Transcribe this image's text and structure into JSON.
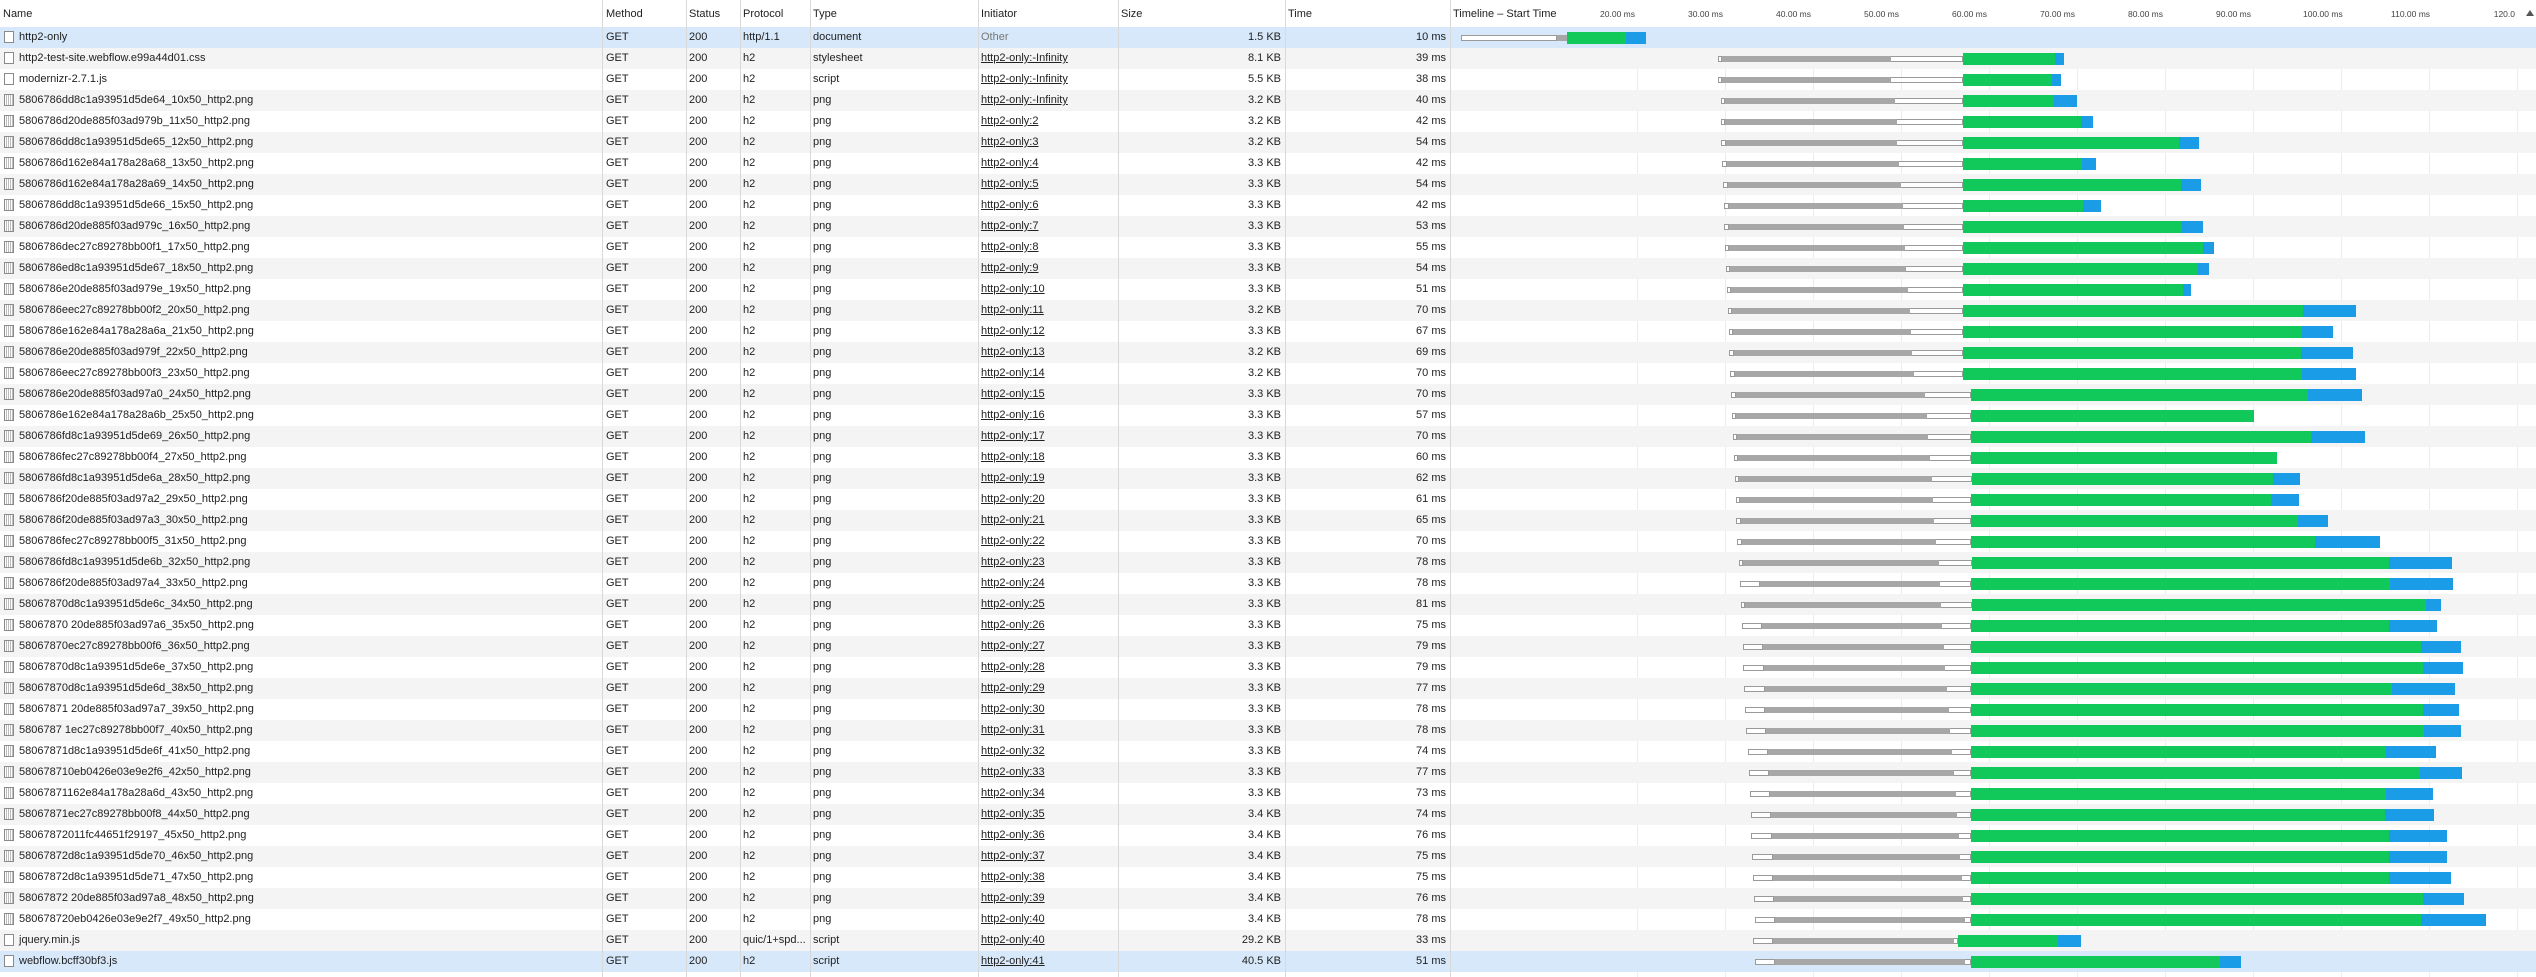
{
  "columns": {
    "name": "Name",
    "method": "Method",
    "status": "Status",
    "protocol": "Protocol",
    "type": "Type",
    "initiator": "Initiator",
    "size": "Size",
    "time": "Time",
    "timeline": "Timeline – Start Time"
  },
  "timeline_ticks": [
    {
      "label": "20.00 ms",
      "ms": 20
    },
    {
      "label": "30.00 ms",
      "ms": 30
    },
    {
      "label": "40.00 ms",
      "ms": 40
    },
    {
      "label": "50.00 ms",
      "ms": 50
    },
    {
      "label": "60.00 ms",
      "ms": 60
    },
    {
      "label": "70.00 ms",
      "ms": 70
    },
    {
      "label": "80.00 ms",
      "ms": 80
    },
    {
      "label": "90.00 ms",
      "ms": 90
    },
    {
      "label": "100.00 ms",
      "ms": 100
    },
    {
      "label": "110.00 ms",
      "ms": 110
    },
    {
      "label": "120.0",
      "ms": 120
    }
  ],
  "icons": {
    "document": "document-icon",
    "stylesheet": "stylesheet-icon",
    "script": "script-icon",
    "png": "image-icon",
    "sort": "sort-ascending-icon"
  },
  "colors": {
    "receiving": "#11c95a",
    "content_download": "#1a9ce6",
    "waiting": "#a7a7a7",
    "selected_row": "#d7e8fa"
  },
  "requests": [
    {
      "name": "http2-only",
      "method": "GET",
      "status": "200",
      "protocol": "http/1.1",
      "type": "document",
      "initiator": "Other",
      "size": "1.5 KB",
      "time": "10 ms",
      "start": 0,
      "queue": 10.9,
      "wait": 1.2,
      "stall": 0,
      "recv": 6.7,
      "dl": 2.2
    },
    {
      "name": "http2-test-site.webflow.e99a44d01.css",
      "method": "GET",
      "status": "200",
      "protocol": "h2",
      "type": "stylesheet",
      "initiator": "http2-only:-Infinity",
      "size": "8.1 KB",
      "time": "39 ms",
      "start": 29.2,
      "queue": 0.5,
      "wait": 19.2,
      "stall": 8.1,
      "recv": 10.5,
      "dl": 1
    },
    {
      "name": "modernizr-2.7.1.js",
      "method": "GET",
      "status": "200",
      "protocol": "h2",
      "type": "script",
      "initiator": "http2-only:-Infinity",
      "size": "5.5 KB",
      "time": "38 ms",
      "start": 29.2,
      "queue": 0.5,
      "wait": 19.2,
      "stall": 8.1,
      "recv": 10.2,
      "dl": 1
    },
    {
      "name": "5806786dd8c1a93951d5de64_10x50_http2.png",
      "method": "GET",
      "status": "200",
      "protocol": "h2",
      "type": "png",
      "initiator": "http2-only:-Infinity",
      "size": "3.2 KB",
      "time": "40 ms",
      "start": 29.5,
      "queue": 0.5,
      "wait": 19.3,
      "stall": 7.7,
      "recv": 10.4,
      "dl": 2.6
    },
    {
      "name": "5806786d20de885f03ad979b_11x50_http2.png",
      "method": "GET",
      "status": "200",
      "protocol": "h2",
      "type": "png",
      "initiator": "http2-only:2",
      "size": "3.2 KB",
      "time": "42 ms",
      "start": 29.5,
      "queue": 0.5,
      "wait": 19.5,
      "stall": 7.5,
      "recv": 13.4,
      "dl": 1.4
    },
    {
      "name": "5806786dd8c1a93951d5de65_12x50_http2.png",
      "method": "GET",
      "status": "200",
      "protocol": "h2",
      "type": "png",
      "initiator": "http2-only:3",
      "size": "3.2 KB",
      "time": "54 ms",
      "start": 29.6,
      "queue": 0.5,
      "wait": 19.5,
      "stall": 7.4,
      "recv": 24.6,
      "dl": 2.3
    },
    {
      "name": "5806786d162e84a178a28a68_13x50_http2.png",
      "method": "GET",
      "status": "200",
      "protocol": "h2",
      "type": "png",
      "initiator": "http2-only:4",
      "size": "3.3 KB",
      "time": "42 ms",
      "start": 29.7,
      "queue": 0.5,
      "wait": 19.6,
      "stall": 7.2,
      "recv": 13.6,
      "dl": 1.6
    },
    {
      "name": "5806786d162e84a178a28a69_14x50_http2.png",
      "method": "GET",
      "status": "200",
      "protocol": "h2",
      "type": "png",
      "initiator": "http2-only:5",
      "size": "3.3 KB",
      "time": "54 ms",
      "start": 29.8,
      "queue": 0.5,
      "wait": 19.7,
      "stall": 7,
      "recv": 24.8,
      "dl": 2.3
    },
    {
      "name": "5806786dd8c1a93951d5de66_15x50_http2.png",
      "method": "GET",
      "status": "200",
      "protocol": "h2",
      "type": "png",
      "initiator": "http2-only:6",
      "size": "3.3 KB",
      "time": "42 ms",
      "start": 29.9,
      "queue": 0.5,
      "wait": 19.8,
      "stall": 6.8,
      "recv": 13.7,
      "dl": 2
    },
    {
      "name": "5806786d20de885f03ad979c_16x50_http2.png",
      "method": "GET",
      "status": "200",
      "protocol": "h2",
      "type": "png",
      "initiator": "http2-only:7",
      "size": "3.3 KB",
      "time": "53 ms",
      "start": 29.9,
      "queue": 0.5,
      "wait": 19.9,
      "stall": 6.7,
      "recv": 24.9,
      "dl": 2.4
    },
    {
      "name": "5806786dec27c89278bb00f1_17x50_http2.png",
      "method": "GET",
      "status": "200",
      "protocol": "h2",
      "type": "png",
      "initiator": "http2-only:8",
      "size": "3.3 KB",
      "time": "55 ms",
      "start": 30,
      "queue": 0.5,
      "wait": 20,
      "stall": 6.5,
      "recv": 27.3,
      "dl": 1.3
    },
    {
      "name": "5806786ed8c1a93951d5de67_18x50_http2.png",
      "method": "GET",
      "status": "200",
      "protocol": "h2",
      "type": "png",
      "initiator": "http2-only:9",
      "size": "3.3 KB",
      "time": "54 ms",
      "start": 30.1,
      "queue": 0.5,
      "wait": 20,
      "stall": 6.4,
      "recv": 26.8,
      "dl": 1.2
    },
    {
      "name": "5806786e20de885f03ad979e_19x50_http2.png",
      "method": "GET",
      "status": "200",
      "protocol": "h2",
      "type": "png",
      "initiator": "http2-only:10",
      "size": "3.3 KB",
      "time": "51 ms",
      "start": 30.2,
      "queue": 0.5,
      "wait": 20.1,
      "stall": 6.2,
      "recv": 25.1,
      "dl": 0.9
    },
    {
      "name": "5806786eec27c89278bb00f2_20x50_http2.png",
      "method": "GET",
      "status": "200",
      "protocol": "h2",
      "type": "png",
      "initiator": "http2-only:11",
      "size": "3.2 KB",
      "time": "70 ms",
      "start": 30.3,
      "queue": 0.5,
      "wait": 20.2,
      "stall": 6,
      "recv": 38.7,
      "dl": 6
    },
    {
      "name": "5806786e162e84a178a28a6a_21x50_http2.png",
      "method": "GET",
      "status": "200",
      "protocol": "h2",
      "type": "png",
      "initiator": "http2-only:12",
      "size": "3.3 KB",
      "time": "67 ms",
      "start": 30.4,
      "queue": 0.5,
      "wait": 20.2,
      "stall": 5.9,
      "recv": 38.6,
      "dl": 3.5
    },
    {
      "name": "5806786e20de885f03ad979f_22x50_http2.png",
      "method": "GET",
      "status": "200",
      "protocol": "h2",
      "type": "png",
      "initiator": "http2-only:13",
      "size": "3.2 KB",
      "time": "69 ms",
      "start": 30.5,
      "queue": 0.5,
      "wait": 20.3,
      "stall": 5.7,
      "recv": 38.5,
      "dl": 5.9
    },
    {
      "name": "5806786eec27c89278bb00f3_23x50_http2.png",
      "method": "GET",
      "status": "200",
      "protocol": "h2",
      "type": "png",
      "initiator": "http2-only:14",
      "size": "3.2 KB",
      "time": "70 ms",
      "start": 30.6,
      "queue": 0.5,
      "wait": 20.4,
      "stall": 5.5,
      "recv": 38.6,
      "dl": 6.1
    },
    {
      "name": "5806786e20de885f03ad97a0_24x50_http2.png",
      "method": "GET",
      "status": "200",
      "protocol": "h2",
      "type": "png",
      "initiator": "http2-only:15",
      "size": "3.3 KB",
      "time": "70 ms",
      "start": 30.7,
      "queue": 0.5,
      "wait": 21.5,
      "stall": 5.3,
      "recv": 38.3,
      "dl": 6.1
    },
    {
      "name": "5806786e162e84a178a28a6b_25x50_http2.png",
      "method": "GET",
      "status": "200",
      "protocol": "h2",
      "type": "png",
      "initiator": "http2-only:16",
      "size": "3.3 KB",
      "time": "57 ms",
      "start": 30.8,
      "queue": 0.5,
      "wait": 21.6,
      "stall": 5.1,
      "recv": 32.1,
      "dl": 0
    },
    {
      "name": "5806786fd8c1a93951d5de69_26x50_http2.png",
      "method": "GET",
      "status": "200",
      "protocol": "h2",
      "type": "png",
      "initiator": "http2-only:17",
      "size": "3.3 KB",
      "time": "70 ms",
      "start": 30.9,
      "queue": 0.5,
      "wait": 21.7,
      "stall": 4.9,
      "recv": 38.6,
      "dl": 6.1
    },
    {
      "name": "5806786fec27c89278bb00f4_27x50_http2.png",
      "method": "GET",
      "status": "200",
      "protocol": "h2",
      "type": "png",
      "initiator": "http2-only:18",
      "size": "3.3 KB",
      "time": "60 ms",
      "start": 31,
      "queue": 0.5,
      "wait": 21.8,
      "stall": 4.7,
      "recv": 34.7,
      "dl": 0
    },
    {
      "name": "5806786fd8c1a93951d5de6a_28x50_http2.png",
      "method": "GET",
      "status": "200",
      "protocol": "h2",
      "type": "png",
      "initiator": "http2-only:19",
      "size": "3.3 KB",
      "time": "62 ms",
      "start": 31.1,
      "queue": 0.5,
      "wait": 21.9,
      "stall": 4.6,
      "recv": 34.2,
      "dl": 3
    },
    {
      "name": "5806786f20de885f03ad97a2_29x50_http2.png",
      "method": "GET",
      "status": "200",
      "protocol": "h2",
      "type": "png",
      "initiator": "http2-only:20",
      "size": "3.3 KB",
      "time": "61 ms",
      "start": 31.2,
      "queue": 0.5,
      "wait": 21.9,
      "stall": 4.4,
      "recv": 34.1,
      "dl": 3.1
    },
    {
      "name": "5806786f20de885f03ad97a3_30x50_http2.png",
      "method": "GET",
      "status": "200",
      "protocol": "h2",
      "type": "png",
      "initiator": "http2-only:21",
      "size": "3.3 KB",
      "time": "65 ms",
      "start": 31.3,
      "queue": 0.5,
      "wait": 22,
      "stall": 4.2,
      "recv": 37.1,
      "dl": 3.4
    },
    {
      "name": "5806786fec27c89278bb00f5_31x50_http2.png",
      "method": "GET",
      "status": "200",
      "protocol": "h2",
      "type": "png",
      "initiator": "http2-only:22",
      "size": "3.3 KB",
      "time": "70 ms",
      "start": 31.4,
      "queue": 0.5,
      "wait": 22.1,
      "stall": 4,
      "recv": 39.1,
      "dl": 7.3
    },
    {
      "name": "5806786fd8c1a93951d5de6b_32x50_http2.png",
      "method": "GET",
      "status": "200",
      "protocol": "h2",
      "type": "png",
      "initiator": "http2-only:23",
      "size": "3.3 KB",
      "time": "78 ms",
      "start": 31.6,
      "queue": 0.5,
      "wait": 22.2,
      "stall": 3.8,
      "recv": 47.4,
      "dl": 7.1
    },
    {
      "name": "5806786f20de885f03ad97a4_33x50_http2.png",
      "method": "GET",
      "status": "200",
      "protocol": "h2",
      "type": "png",
      "initiator": "http2-only:24",
      "size": "3.3 KB",
      "time": "78 ms",
      "start": 31.7,
      "queue": 2.3,
      "wait": 20.4,
      "stall": 3.6,
      "recv": 47.6,
      "dl": 7.1
    },
    {
      "name": "58067870d8c1a93951d5de6c_34x50_http2.png",
      "method": "GET",
      "status": "200",
      "protocol": "h2",
      "type": "png",
      "initiator": "http2-only:25",
      "size": "3.3 KB",
      "time": "81 ms",
      "start": 31.8,
      "queue": 0.5,
      "wait": 22.3,
      "stall": 3.5,
      "recv": 51.6,
      "dl": 1.7
    },
    {
      "name": "58067870 20de885f03ad97a6_35x50_http2.png",
      "method": "GET",
      "status": "200",
      "protocol": "h2",
      "type": "png",
      "initiator": "http2-only:26",
      "size": "3.3 KB",
      "time": "75 ms",
      "start": 31.9,
      "queue": 2.3,
      "wait": 20.5,
      "stall": 3.3,
      "recv": 47.4,
      "dl": 5.5
    },
    {
      "name": "58067870ec27c89278bb00f6_36x50_http2.png",
      "method": "GET",
      "status": "200",
      "protocol": "h2",
      "type": "png",
      "initiator": "http2-only:27",
      "size": "3.3 KB",
      "time": "79 ms",
      "start": 32,
      "queue": 2.3,
      "wait": 20.6,
      "stall": 3.1,
      "recv": 51.1,
      "dl": 4.5
    },
    {
      "name": "58067870d8c1a93951d5de6e_37x50_http2.png",
      "method": "GET",
      "status": "200",
      "protocol": "h2",
      "type": "png",
      "initiator": "http2-only:28",
      "size": "3.3 KB",
      "time": "79 ms",
      "start": 32.1,
      "queue": 2.3,
      "wait": 20.6,
      "stall": 2.9,
      "recv": 51.4,
      "dl": 4.6
    },
    {
      "name": "58067870d8c1a93951d5de6d_38x50_http2.png",
      "method": "GET",
      "status": "200",
      "protocol": "h2",
      "type": "png",
      "initiator": "http2-only:29",
      "size": "3.3 KB",
      "time": "77 ms",
      "start": 32.2,
      "queue": 2.3,
      "wait": 20.7,
      "stall": 2.7,
      "recv": 47.9,
      "dl": 7.2
    },
    {
      "name": "58067871 20de885f03ad97a7_39x50_http2.png",
      "method": "GET",
      "status": "200",
      "protocol": "h2",
      "type": "png",
      "initiator": "http2-only:30",
      "size": "3.3 KB",
      "time": "78 ms",
      "start": 32.3,
      "queue": 2.3,
      "wait": 20.8,
      "stall": 2.5,
      "recv": 51.4,
      "dl": 4.1
    },
    {
      "name": "5806787 1ec27c89278bb00f7_40x50_http2.png",
      "method": "GET",
      "status": "200",
      "protocol": "h2",
      "type": "png",
      "initiator": "http2-only:31",
      "size": "3.3 KB",
      "time": "78 ms",
      "start": 32.4,
      "queue": 2.3,
      "wait": 20.9,
      "stall": 2.4,
      "recv": 51.4,
      "dl": 4.2
    },
    {
      "name": "58067871d8c1a93951d5de6f_41x50_http2.png",
      "method": "GET",
      "status": "200",
      "protocol": "h2",
      "type": "png",
      "initiator": "http2-only:32",
      "size": "3.3 KB",
      "time": "74 ms",
      "start": 32.6,
      "queue": 2.3,
      "wait": 20.9,
      "stall": 2.2,
      "recv": 47.1,
      "dl": 5.7
    },
    {
      "name": "580678710eb0426e03e9e2f6_42x50_http2.png",
      "method": "GET",
      "status": "200",
      "protocol": "h2",
      "type": "png",
      "initiator": "http2-only:33",
      "size": "3.3 KB",
      "time": "77 ms",
      "start": 32.7,
      "queue": 2.3,
      "wait": 21,
      "stall": 2,
      "recv": 51,
      "dl": 4.8
    },
    {
      "name": "58067871162e84a178a28a6d_43x50_http2.png",
      "method": "GET",
      "status": "200",
      "protocol": "h2",
      "type": "png",
      "initiator": "http2-only:34",
      "size": "3.3 KB",
      "time": "73 ms",
      "start": 32.8,
      "queue": 2.3,
      "wait": 21.1,
      "stall": 1.8,
      "recv": 47.1,
      "dl": 5.4
    },
    {
      "name": "58067871ec27c89278bb00f8_44x50_http2.png",
      "method": "GET",
      "status": "200",
      "protocol": "h2",
      "type": "png",
      "initiator": "http2-only:35",
      "size": "3.4 KB",
      "time": "74 ms",
      "start": 32.9,
      "queue": 2.3,
      "wait": 21.2,
      "stall": 1.6,
      "recv": 47,
      "dl": 5.6
    },
    {
      "name": "58067872011fc44651f29197_45x50_http2.png",
      "method": "GET",
      "status": "200",
      "protocol": "h2",
      "type": "png",
      "initiator": "http2-only:36",
      "size": "3.4 KB",
      "time": "76 ms",
      "start": 33,
      "queue": 2.3,
      "wait": 21.3,
      "stall": 1.4,
      "recv": 47.5,
      "dl": 6.6
    },
    {
      "name": "58067872d8c1a93951d5de70_46x50_http2.png",
      "method": "GET",
      "status": "200",
      "protocol": "h2",
      "type": "png",
      "initiator": "http2-only:37",
      "size": "3.4 KB",
      "time": "75 ms",
      "start": 33.1,
      "queue": 2.3,
      "wait": 21.3,
      "stall": 1.3,
      "recv": 47.5,
      "dl": 6.6
    },
    {
      "name": "58067872d8c1a93951d5de71_47x50_http2.png",
      "method": "GET",
      "status": "200",
      "protocol": "h2",
      "type": "png",
      "initiator": "http2-only:38",
      "size": "3.4 KB",
      "time": "75 ms",
      "start": 33.2,
      "queue": 2.3,
      "wait": 21.4,
      "stall": 1.1,
      "recv": 47.5,
      "dl": 7
    },
    {
      "name": "58067872 20de885f03ad97a8_48x50_http2.png",
      "method": "GET",
      "status": "200",
      "protocol": "h2",
      "type": "png",
      "initiator": "http2-only:39",
      "size": "3.4 KB",
      "time": "76 ms",
      "start": 33.3,
      "queue": 2.3,
      "wait": 21.5,
      "stall": 0.9,
      "recv": 51.3,
      "dl": 4.7
    },
    {
      "name": "580678720eb0426e03e9e2f7_49x50_http2.png",
      "method": "GET",
      "status": "200",
      "protocol": "h2",
      "type": "png",
      "initiator": "http2-only:40",
      "size": "3.4 KB",
      "time": "78 ms",
      "start": 33.4,
      "queue": 2.3,
      "wait": 21.6,
      "stall": 0.7,
      "recv": 51.1,
      "dl": 7.4
    },
    {
      "name": "jquery.min.js",
      "method": "GET",
      "status": "200",
      "protocol": "quic/1+spd...",
      "type": "script",
      "initiator": "http2-only:40",
      "size": "29.2 KB",
      "time": "33 ms",
      "start": 33.2,
      "queue": 2.3,
      "wait": 20.5,
      "stall": 0.5,
      "recv": 11.3,
      "dl": 2.6
    },
    {
      "name": "webflow.bcff30bf3.js",
      "method": "GET",
      "status": "200",
      "protocol": "h2",
      "type": "script",
      "initiator": "http2-only:41",
      "size": "40.5 KB",
      "time": "51 ms",
      "start": 33.4,
      "queue": 2.3,
      "wait": 21.6,
      "stall": 0.7,
      "recv": 28.2,
      "dl": 2.4
    }
  ]
}
